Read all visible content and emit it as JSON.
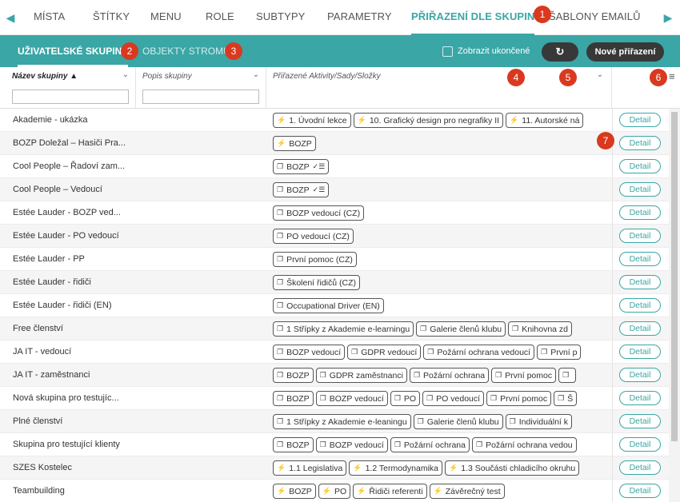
{
  "topnav": {
    "tabs": [
      "MÍSTA",
      "ŠTÍTKY",
      "MENU",
      "ROLE",
      "SUBTYPY",
      "PARAMETRY",
      "PŘIŘAZENÍ DLE SKUPIN",
      "ŠABLONY EMAILŮ"
    ],
    "left_arrow_icon": "chevron-left-icon",
    "right_arrow_icon": "chevron-right-icon"
  },
  "subbar": {
    "tab_groups": "UŽIVATELSKÉ SKUPINY",
    "tab_tree": "OBJEKTY STROMU",
    "show_ended_label": "Zobrazit ukončené",
    "refresh_icon": "refresh-icon",
    "new_assignment": "Nové přiřazení"
  },
  "badges": [
    "1",
    "2",
    "3",
    "4",
    "5",
    "6",
    "7"
  ],
  "table": {
    "col_name": "Název skupiny",
    "col_desc": "Popis skupiny",
    "col_assigned": "Přiřazené Aktivity/Sady/Složky",
    "detail_label": "Detail",
    "rows": [
      {
        "name": "Akademie - ukázka",
        "tags": [
          {
            "icon": "⚡",
            "text": "1. Úvodní lekce"
          },
          {
            "icon": "⚡",
            "text": "10. Grafický design pro negrafiky II"
          },
          {
            "icon": "⚡",
            "text": "11. Autorské ná"
          }
        ]
      },
      {
        "name": "BOZP Doležal – Hasiči Pra...",
        "tags": [
          {
            "icon": "⚡",
            "text": "BOZP"
          }
        ]
      },
      {
        "name": "Cool People – Řadoví zam...",
        "tags": [
          {
            "icon": "❐",
            "text": "BOZP",
            "extra": "✓☰"
          }
        ]
      },
      {
        "name": "Cool People – Vedoucí",
        "tags": [
          {
            "icon": "❐",
            "text": "BOZP",
            "extra": "✓☰"
          }
        ]
      },
      {
        "name": "Estée Lauder - BOZP ved...",
        "tags": [
          {
            "icon": "❐",
            "text": "BOZP vedoucí (CZ)"
          }
        ]
      },
      {
        "name": "Estée Lauder - PO vedoucí",
        "tags": [
          {
            "icon": "❐",
            "text": "PO vedoucí (CZ)"
          }
        ]
      },
      {
        "name": "Estée Lauder - PP",
        "tags": [
          {
            "icon": "❐",
            "text": "První pomoc (CZ)"
          }
        ]
      },
      {
        "name": "Estée Lauder - řidiči",
        "tags": [
          {
            "icon": "❐",
            "text": "Školení řidičů (CZ)"
          }
        ]
      },
      {
        "name": "Estée Lauder - řidiči (EN)",
        "tags": [
          {
            "icon": "❐",
            "text": "Occupational Driver (EN)"
          }
        ]
      },
      {
        "name": "Free členství",
        "tags": [
          {
            "icon": "❐",
            "text": "1 Střípky z Akademie e-learningu"
          },
          {
            "icon": "❐",
            "text": "Galerie členů klubu"
          },
          {
            "icon": "❐",
            "text": "Knihovna zd"
          }
        ]
      },
      {
        "name": "JA IT - vedoucí",
        "tags": [
          {
            "icon": "❐",
            "text": "BOZP vedoucí"
          },
          {
            "icon": "❐",
            "text": "GDPR vedoucí"
          },
          {
            "icon": "❐",
            "text": "Požární ochrana vedoucí"
          },
          {
            "icon": "❐",
            "text": "První p"
          }
        ]
      },
      {
        "name": "JA IT - zaměstnanci",
        "tags": [
          {
            "icon": "❐",
            "text": "BOZP"
          },
          {
            "icon": "❐",
            "text": "GDPR zaměstnanci"
          },
          {
            "icon": "❐",
            "text": "Požární ochrana"
          },
          {
            "icon": "❐",
            "text": "První pomoc"
          },
          {
            "icon": "❐",
            "text": ""
          }
        ]
      },
      {
        "name": "Nová skupina pro testujíc...",
        "tags": [
          {
            "icon": "❐",
            "text": "BOZP"
          },
          {
            "icon": "❐",
            "text": "BOZP vedoucí"
          },
          {
            "icon": "❐",
            "text": "PO"
          },
          {
            "icon": "❐",
            "text": "PO vedoucí"
          },
          {
            "icon": "❐",
            "text": "První pomoc"
          },
          {
            "icon": "❐",
            "text": "Š"
          }
        ]
      },
      {
        "name": "Plné členství",
        "tags": [
          {
            "icon": "❐",
            "text": "1 Střípky z Akademie e-leaningu"
          },
          {
            "icon": "❐",
            "text": "Galerie členů klubu"
          },
          {
            "icon": "❐",
            "text": "Individuální k"
          }
        ]
      },
      {
        "name": "Skupina pro testující klienty",
        "tags": [
          {
            "icon": "❐",
            "text": "BOZP"
          },
          {
            "icon": "❐",
            "text": "BOZP vedoucí"
          },
          {
            "icon": "❐",
            "text": "Požární ochrana"
          },
          {
            "icon": "❐",
            "text": "Požární ochrana vedou"
          }
        ]
      },
      {
        "name": "SZES Kostelec",
        "tags": [
          {
            "icon": "⚡",
            "text": "1.1 Legislativa"
          },
          {
            "icon": "⚡",
            "text": "1.2 Termodynamika"
          },
          {
            "icon": "⚡",
            "text": "1.3 Součásti chladicího okruhu"
          }
        ]
      },
      {
        "name": "Teambuilding",
        "tags": [
          {
            "icon": "⚡",
            "text": "BOZP"
          },
          {
            "icon": "⚡",
            "text": "PO"
          },
          {
            "icon": "⚡",
            "text": "Řidiči referenti"
          },
          {
            "icon": "⚡",
            "text": "Závěrečný test"
          }
        ]
      }
    ]
  },
  "colors": {
    "accent": "#3aa6a5",
    "badge": "#d9391f",
    "dark_button": "#383838"
  }
}
